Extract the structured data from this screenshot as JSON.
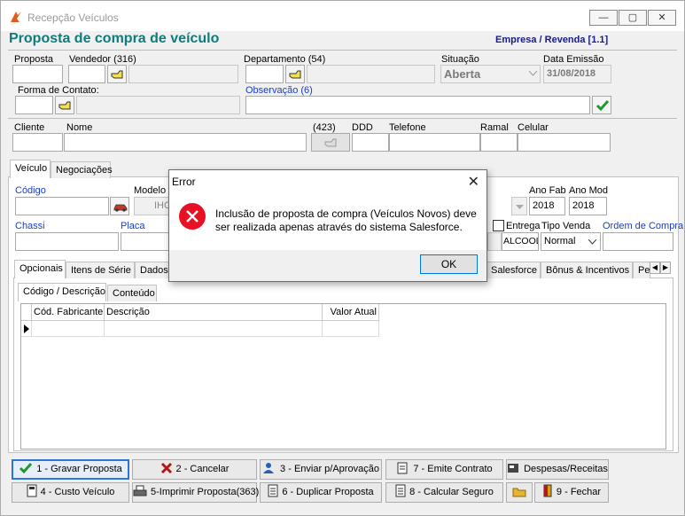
{
  "window": {
    "title": "Recepção Veículos",
    "minimize": "—",
    "maximize": "▢",
    "close": "✕"
  },
  "header": {
    "title": "Proposta de compra de veículo",
    "company": "Empresa / Revenda [1.1]"
  },
  "proposal": {
    "proposta_label": "Proposta",
    "vendedor_label": "Vendedor (316)",
    "departamento_label": "Departamento (54)",
    "situacao_label": "Situação",
    "situacao_value": "Aberta",
    "data_emissao_label": "Data Emissão",
    "data_emissao_value": "31/08/2018",
    "forma_contato_label": "Forma de Contato:",
    "observacao_label": "Observação (6)"
  },
  "client": {
    "cliente_label": "Cliente",
    "nome_label": "Nome",
    "count_label": "(423)",
    "ddd_label": "DDD",
    "telefone_label": "Telefone",
    "ramal_label": "Ramal",
    "celular_label": "Celular"
  },
  "main_tabs": [
    {
      "label": "Veículo"
    },
    {
      "label": "Negociações"
    }
  ],
  "vehicle": {
    "codigo_label": "Código",
    "modelo_label": "Modelo",
    "modelo_value": "IHC",
    "ano_fab_label": "Ano Fab",
    "ano_fab_value": "2018",
    "ano_mod_label": "Ano Mod",
    "ano_mod_value": "2018",
    "chassi_label": "Chassi",
    "placa_label": "Placa",
    "entrega_label": "Entrega",
    "tipo_venda_label": "Tipo Venda",
    "tipo_venda_value": "Normal",
    "ordem_compra_label": "Ordem de Compra",
    "combustivel_value": "ALCOOL"
  },
  "sub_tabs": [
    {
      "label": "Opcionais"
    },
    {
      "label": "Itens de Série"
    },
    {
      "label": "Dados"
    },
    {
      "label": "Salesforce"
    },
    {
      "label": "Bônus & Incentivos"
    },
    {
      "label": "Pe"
    }
  ],
  "inner_tabs": [
    {
      "label": "Código / Descrição"
    },
    {
      "label": "Conteúdo"
    }
  ],
  "grid": {
    "columns": [
      "Cód. Fabricante",
      "Descrição",
      "Valor Atual"
    ]
  },
  "buttons": {
    "gravar": "1 - Gravar Proposta",
    "cancelar": "2 - Cancelar",
    "enviar": "3 - Enviar p/Aprovação",
    "emite": "7 - Emite Contrato",
    "despesas": "Despesas/Receitas",
    "custo": "4 - Custo Veículo",
    "imprimir": "5-Imprimir Proposta(363)",
    "duplicar": "6 - Duplicar Proposta",
    "calcular": "8 - Calcular Seguro",
    "fechar": "9 - Fechar"
  },
  "dialog": {
    "title": "Error",
    "close": "✕",
    "message": "Inclusão de proposta de compra (Veículos Novos) deve ser realizada apenas através do sistema Salesforce.",
    "ok": "OK"
  },
  "colors": {
    "heading": "#0c7c7c",
    "company": "#1a1a8a",
    "label_blue": "#1b3ec4",
    "error_icon": "#e81123",
    "focus_border": "#2a76d2"
  }
}
